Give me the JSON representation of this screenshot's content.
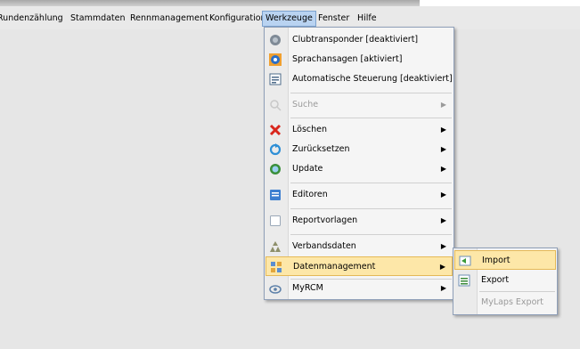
{
  "menubar": {
    "items": [
      {
        "label": "Rundenzählung",
        "active": false
      },
      {
        "label": "Stammdaten",
        "active": false
      },
      {
        "label": "Rennmanagement",
        "active": false
      },
      {
        "label": "Konfiguration",
        "active": false
      },
      {
        "label": "Werkzeuge",
        "active": true
      },
      {
        "label": "Fenster",
        "active": false
      },
      {
        "label": "Hilfe",
        "active": false
      }
    ]
  },
  "werkzeuge_menu": {
    "items": [
      {
        "label": "Clubtransponder [deaktiviert]",
        "icon": "transponder-icon",
        "enabled": true,
        "submenu": false
      },
      {
        "label": "Sprachansagen [aktiviert]",
        "icon": "speech-icon",
        "enabled": true,
        "submenu": false
      },
      {
        "label": "Automatische Steuerung [deaktiviert]",
        "icon": "automation-icon",
        "enabled": true,
        "submenu": false
      },
      {
        "label": "Suche",
        "icon": "search-icon",
        "enabled": false,
        "submenu": true
      },
      {
        "label": "Löschen",
        "icon": "delete-icon",
        "enabled": true,
        "submenu": true
      },
      {
        "label": "Zurücksetzen",
        "icon": "reset-icon",
        "enabled": true,
        "submenu": true
      },
      {
        "label": "Update",
        "icon": "update-icon",
        "enabled": true,
        "submenu": true
      },
      {
        "label": "Editoren",
        "icon": "editor-icon",
        "enabled": true,
        "submenu": true
      },
      {
        "label": "Reportvorlagen",
        "icon": "report-template-icon",
        "enabled": true,
        "submenu": true
      },
      {
        "label": "Verbandsdaten",
        "icon": "association-icon",
        "enabled": true,
        "submenu": true
      },
      {
        "label": "Datenmanagement",
        "icon": "data-management-icon",
        "enabled": true,
        "submenu": true,
        "highlighted": true
      },
      {
        "label": "MyRCM",
        "icon": "cloud-icon",
        "enabled": true,
        "submenu": true
      }
    ]
  },
  "datenmanagement_submenu": {
    "items": [
      {
        "label": "Import",
        "icon": "import-icon",
        "enabled": true,
        "highlighted": true
      },
      {
        "label": "Export",
        "icon": "export-icon",
        "enabled": true
      },
      {
        "label": "MyLaps Export",
        "icon": "",
        "enabled": false
      }
    ]
  },
  "colors": {
    "highlight": "#fde7a8",
    "menubar_active": "#b9d3f1"
  }
}
